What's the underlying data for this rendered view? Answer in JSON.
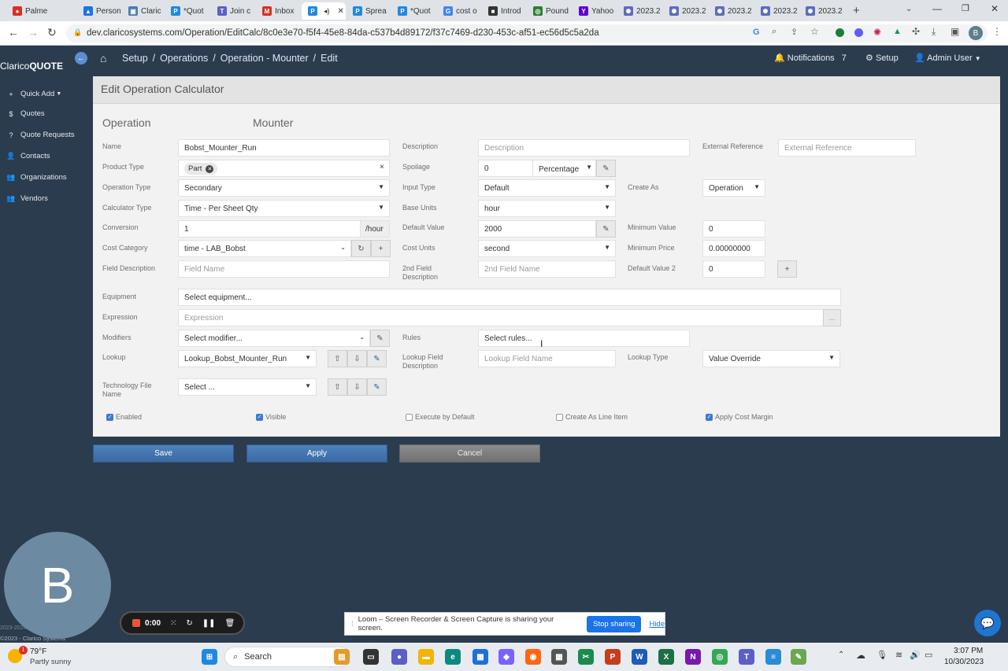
{
  "browser": {
    "tabs": [
      {
        "label": "Palme",
        "icon": "record-icon",
        "color": "#d93025"
      },
      {
        "label": "Person",
        "icon": "drive-icon",
        "color": "#1a73e8"
      },
      {
        "label": "Claric",
        "icon": "clarico-icon",
        "color": "#4a7bb7"
      },
      {
        "label": "*Quot",
        "icon": "pancake-icon",
        "color": "#1e88e5"
      },
      {
        "label": "Join c",
        "icon": "teams-icon",
        "color": "#5b5fc7"
      },
      {
        "label": "Inbox",
        "icon": "gmail-icon",
        "color": "#d93025"
      },
      {
        "label": "",
        "icon": "pancake-icon",
        "color": "#1e88e5"
      },
      {
        "label": "Sprea",
        "icon": "pancake-icon",
        "color": "#1e88e5"
      },
      {
        "label": "*Quot",
        "icon": "pancake-icon",
        "color": "#1e88e5"
      },
      {
        "label": "cost o",
        "icon": "google-icon",
        "color": "#4285f4"
      },
      {
        "label": "Introd",
        "icon": "square-icon",
        "color": "#333333"
      },
      {
        "label": "Pound",
        "icon": "pound-icon",
        "color": "#2e7d32"
      },
      {
        "label": "Yahoo",
        "icon": "yahoo-icon",
        "color": "#6001d2"
      },
      {
        "label": "2023.2",
        "icon": "gear-flower-icon",
        "color": "#5c6bc0"
      },
      {
        "label": "2023.2",
        "icon": "gear-flower-icon",
        "color": "#5c6bc0"
      },
      {
        "label": "2023.2",
        "icon": "gear-flower-icon",
        "color": "#5c6bc0"
      },
      {
        "label": "2023.2",
        "icon": "gear-flower-icon",
        "color": "#5c6bc0"
      },
      {
        "label": "2023.2",
        "icon": "gear-flower-icon",
        "color": "#5c6bc0"
      }
    ],
    "url": "dev.claricosystems.com/Operation/EditCalc/8c0e3e70-f5f4-45e8-84da-c537b4d89172/f37c7469-d230-453c-af51-ec56d5c5a2da",
    "profile_initial": "B"
  },
  "app": {
    "logo_prefix": "Clarico",
    "logo_suffix": "QUOTE",
    "breadcrumb": [
      "Setup",
      "Operations",
      "Operation - Mounter",
      "Edit"
    ],
    "breadcrumb_sep": "/",
    "notifications_label": "Notifications",
    "notifications_count": "7",
    "setup_label": "Setup",
    "user_label": "Admin User",
    "accent": "#3b6ea5"
  },
  "sidebar": {
    "quick_add": "Quick Add",
    "items": [
      {
        "label": "Quotes",
        "icon": "dollar-icon"
      },
      {
        "label": "Quote Requests",
        "icon": "question-icon"
      },
      {
        "label": "Contacts",
        "icon": "person-icon"
      },
      {
        "label": "Organizations",
        "icon": "people-icon"
      },
      {
        "label": "Vendors",
        "icon": "people-icon"
      }
    ],
    "footer_year": "2023-2024",
    "footer_copy": "©2023 - Clarico Systems"
  },
  "form": {
    "panel_title": "Edit Operation Calculator",
    "section_label": "Operation",
    "section_value": "Mounter",
    "name": {
      "label": "Name",
      "value": "Bobst_Mounter_Run"
    },
    "product_type": {
      "label": "Product Type",
      "tag": "Part"
    },
    "operation_type": {
      "label": "Operation Type",
      "value": "Secondary"
    },
    "calculator_type": {
      "label": "Calculator Type",
      "value": "Time - Per Sheet Qty"
    },
    "conversion": {
      "label": "Conversion",
      "value": "1",
      "suffix": "/hour"
    },
    "cost_category": {
      "label": "Cost Category",
      "value": "time - LAB_Bobst"
    },
    "field_description": {
      "label": "Field Description",
      "placeholder": "Field Name"
    },
    "description": {
      "label": "Description",
      "placeholder": "Description"
    },
    "spoilage": {
      "label": "Spoilage",
      "value": "0",
      "unit": "Percentage"
    },
    "input_type": {
      "label": "Input Type",
      "value": "Default"
    },
    "base_units": {
      "label": "Base Units",
      "value": "hour"
    },
    "default_value": {
      "label": "Default Value",
      "value": "2000"
    },
    "cost_units": {
      "label": "Cost Units",
      "value": "second"
    },
    "field2_description": {
      "label_1": "2nd Field",
      "label_2": "Description",
      "placeholder": "2nd Field Name"
    },
    "external_reference": {
      "label": "External Reference",
      "placeholder": "External Reference"
    },
    "create_as": {
      "label": "Create As",
      "value": "Operation"
    },
    "minimum_value": {
      "label": "Minimum Value",
      "value": "0"
    },
    "minimum_price": {
      "label": "Minimum Price",
      "value": "0.00000000"
    },
    "default_value_2": {
      "label": "Default Value 2",
      "value": "0"
    },
    "equipment": {
      "label": "Equipment",
      "value": "Select equipment..."
    },
    "expression": {
      "label": "Expression",
      "placeholder": "Expression",
      "btn": "..."
    },
    "modifiers": {
      "label": "Modifiers",
      "value": "Select modifier..."
    },
    "rules": {
      "label": "Rules",
      "value": "Select rules..."
    },
    "lookup": {
      "label": "Lookup",
      "value": "Lookup_Bobst_Mounter_Run"
    },
    "lookup_field_description": {
      "label_1": "Lookup Field",
      "label_2": "Description",
      "placeholder": "Lookup Field Name"
    },
    "lookup_type": {
      "label": "Lookup Type",
      "value": "Value Override"
    },
    "technology_file_name": {
      "label_1": "Technology File",
      "label_2": "Name",
      "value": "Select ..."
    },
    "checkboxes": [
      {
        "label": "Enabled",
        "checked": true
      },
      {
        "label": "Visible",
        "checked": true
      },
      {
        "label": "Execute by Default",
        "checked": false
      },
      {
        "label": "Create As Line Item",
        "checked": false
      },
      {
        "label": "Apply Cost Margin",
        "checked": true
      }
    ],
    "save_label": "Save",
    "apply_label": "Apply",
    "cancel_label": "Cancel"
  },
  "overlay": {
    "avatar_letter": "B",
    "rec_time": "0:00",
    "loom_message": "Loom – Screen Recorder & Screen Capture is sharing your screen.",
    "stop_sharing": "Stop sharing",
    "hide": "Hide"
  },
  "taskbar": {
    "weather_temp": "79°F",
    "weather_desc": "Partly sunny",
    "weather_badge": "1",
    "search_label": "Search",
    "time": "3:07 PM",
    "date": "10/30/2023"
  }
}
